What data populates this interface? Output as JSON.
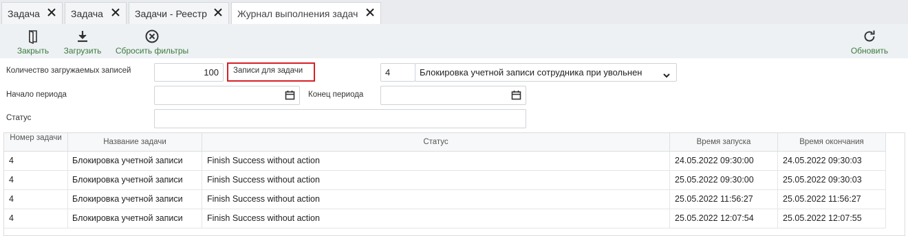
{
  "tabs": [
    {
      "label": "Задача"
    },
    {
      "label": "Задача"
    },
    {
      "label": "Задачи - Реестр"
    },
    {
      "label": "Журнал выполнения задач"
    }
  ],
  "toolbar": {
    "close_label": "Закрыть",
    "load_label": "Загрузить",
    "reset_label": "Сбросить фильтры",
    "refresh_label": "Обновить"
  },
  "form": {
    "count_label": "Количество загружаемых записей",
    "count_value": "100",
    "task_records_label": "Записи для задачи",
    "task_id_value": "4",
    "task_name_value": "Блокировка учетной записи сотрудника при увольнен",
    "period_start_label": "Начало периода",
    "period_end_label": "Конец периода",
    "status_label": "Статус"
  },
  "table": {
    "headers": [
      "Номер задачи",
      "Название задачи",
      "Статус",
      "Время запуска",
      "Время окончания"
    ],
    "rows": [
      [
        "4",
        "Блокировка учетной записи",
        "Finish Success without action",
        "24.05.2022 09:30:00",
        "24.05.2022 09:30:03"
      ],
      [
        "4",
        "Блокировка учетной записи",
        "Finish Success without action",
        "25.05.2022 09:30:00",
        "25.05.2022 09:30:03"
      ],
      [
        "4",
        "Блокировка учетной записи",
        "Finish Success without action",
        "25.05.2022 11:56:27",
        "25.05.2022 11:56:27"
      ],
      [
        "4",
        "Блокировка учетной записи",
        "Finish Success without action",
        "25.05.2022 12:07:54",
        "25.05.2022 12:07:55"
      ]
    ]
  },
  "colors": {
    "accent_green": "#3d7a3d",
    "highlight_red": "#d61f26"
  }
}
